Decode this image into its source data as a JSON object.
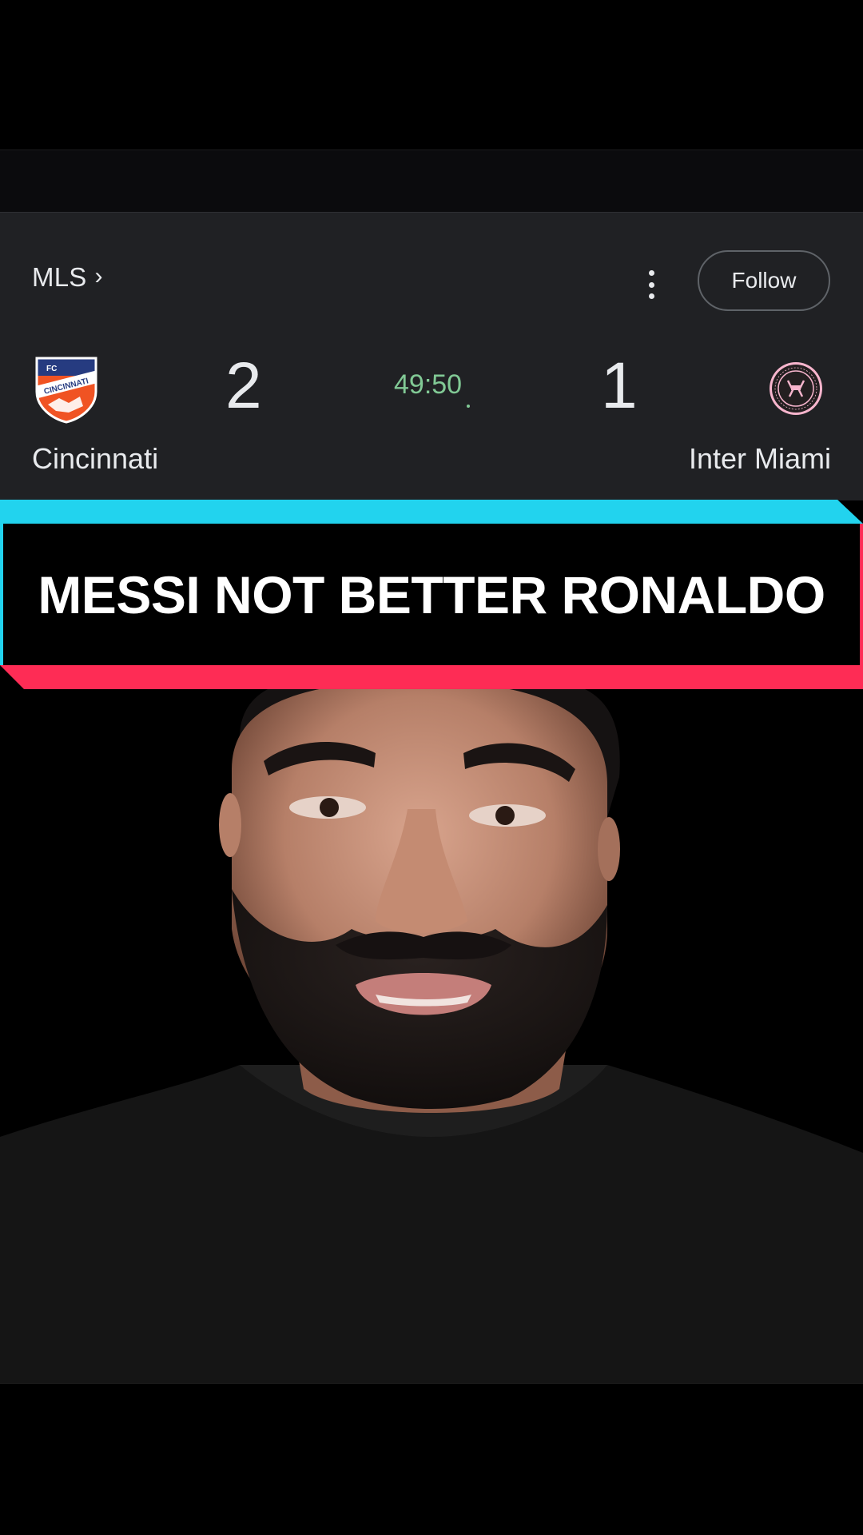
{
  "scorecard": {
    "league_label": "MLS",
    "league_chevron": "›",
    "more_icon": "more-vert-icon",
    "follow_label": "Follow",
    "home": {
      "name": "Cincinnati",
      "score": "2",
      "crest_text_top": "FC",
      "crest_text_main": "CINCINNATI"
    },
    "away": {
      "name": "Inter Miami",
      "score": "1"
    },
    "clock": "49:50",
    "clock_color": "#81c995"
  },
  "banner": {
    "title": "MESSI NOT BETTER RONALDO",
    "accent_top": "#22d3ee",
    "accent_bottom": "#fe2c55"
  },
  "video": {
    "subject": "person-talking"
  }
}
